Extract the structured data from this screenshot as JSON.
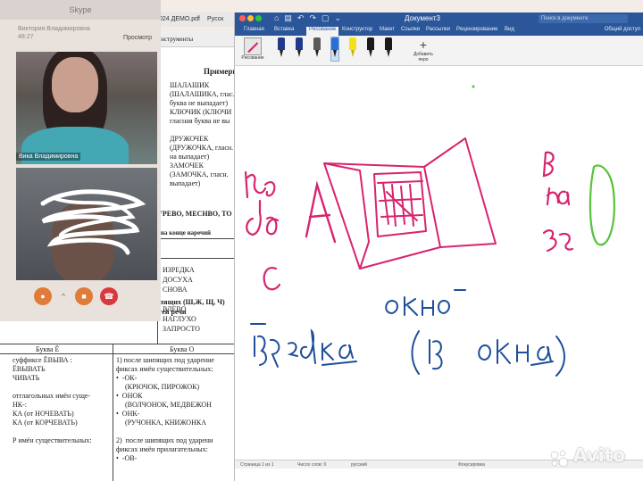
{
  "skype": {
    "title": "Skype",
    "user_name": "Виктория Владимировна",
    "user_time": "48:27",
    "participant_name": "Вика Владимировна",
    "controls": {
      "mic": "mic-icon",
      "camera": "camera-icon",
      "end": "end-call-icon"
    }
  },
  "pdf_tabs": {
    "tab1": "024 ДЕМО.pdf",
    "tab2": "Русск",
    "view_label": "Просмотр",
    "toolbar_text": "Найти текст или инструменты"
  },
  "doc": {
    "col_head": "Примеры",
    "words_top": "ШАЛАШИК\n(ШАЛАШИКА, глас.\nбуква не выпадает)\nКЛЮЧИК (КЛЮЧИ\nгласная буква не вы\n\nДРУЖОЧЕК\n(ДРУЖОЧКА, гласн.\nна выпадает)\nЗАМОЧЕК\n(ЗАМОЧКА, гласн.\nвыпадает)",
    "rule_line": "УРЕВО, МЕСНВО, ТО",
    "rule_line2": "на конце наречий",
    "adverbs": "ИЗРЕДКА\nДОСУХА\nСНОВА\n\nВЛЕВО\nНАГЛУХО\nЗАПРОСТО",
    "section_title": "5. Правописание букв О, Ё после шипящих (Ш,Ж, Щ, Ч)\nв суффиксах разных частей речи",
    "col_left_head": "Буква Ё",
    "col_right_head": "Буква О",
    "left_col": "суффиксе ЁВЫВА :\nЁВЫВАТЬ\nЧИВАТЬ\n\nотглагольных имён суще-\nНК-:\nКА (от НОЧЕВАТЬ)\nКА (от КОРЧЕВАТЬ)\n\nР имён существительных:",
    "right_col": "1) после шипящих под ударение\nфиксах имён существительных:\n•  -ОК-\n     (КРЮЧОК, ПИРОЖОК)\n•  ОНОК\n     (ВОЛЧОНОК, МЕДВЕЖОН\n•  ОНК-\n     (РУЧОНКА, КНИЖОНКА\n\n2)  после шипящих под ударени\nфиксах имён прилагательных:\n•  -ОВ-"
  },
  "word": {
    "title": "Документ3",
    "search_placeholder": "Поиск в документе",
    "share_label": "Общий доступ",
    "tabs": [
      "Главная",
      "Вставка",
      "Рисование",
      "Конструктор",
      "Макет",
      "Ссылки",
      "Рассылки",
      "Рецензирование",
      "Вид"
    ],
    "active_tab": "Рисование",
    "draw_tool_label": "Рисование",
    "add_pen_label": "Добавить перо",
    "pens": [
      {
        "color": "#1f3a8a",
        "kind": "pen"
      },
      {
        "color": "#1f3a8a",
        "kind": "pen"
      },
      {
        "color": "#5a5a5a",
        "kind": "pencil"
      },
      {
        "color": "#2a6fd8",
        "kind": "pen"
      },
      {
        "color": "#f5e11a",
        "kind": "highlighter"
      },
      {
        "color": "#1a1a1a",
        "kind": "pen"
      },
      {
        "color": "#1a1a1a",
        "kind": "pen"
      }
    ],
    "status": {
      "page": "Страница 1 из 1",
      "words": "Число слов: 0",
      "language": "русский",
      "focus": "Фокусировка"
    }
  },
  "handwriting": {
    "izdo": "из до с",
    "a": "А",
    "v_na_za": "в на за",
    "o": "О",
    "okno": "окно",
    "izredka": "изредка",
    "iz_okna": "(из окна)",
    "colors": {
      "pink": "#d8246f",
      "blue": "#1f4e9a",
      "green": "#58c23c"
    }
  },
  "watermark": "Avito"
}
